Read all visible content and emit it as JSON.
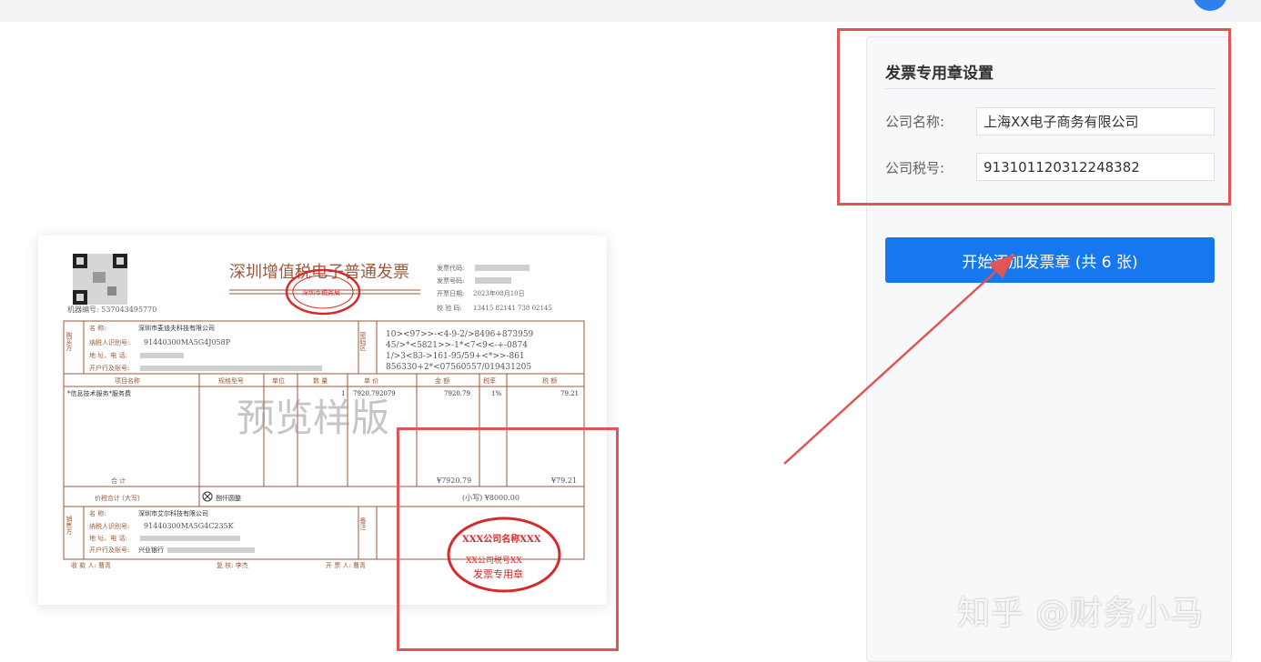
{
  "panel": {
    "title": "发票专用章设置",
    "company_name_label": "公司名称:",
    "company_name_value": "上海XX电子商务有限公司",
    "tax_id_label": "公司税号:",
    "tax_id_value": "913101120312248382",
    "start_button_label": "开始添加发票章 (共 6 张)"
  },
  "invoice": {
    "title": "深圳增值税电子普通发票",
    "machine_no": "机器编号: 537043495770",
    "code_label": "发票代码:",
    "number_label": "发票号码:",
    "date_label": "开票日期:",
    "date_value": "2023年08月10日",
    "check_label": "校 验 码:",
    "check_value": "13415 82141 738 02145",
    "buyer_side": "购买方",
    "buyer_name_label": "名    称:",
    "buyer_name": "深圳市麦迪夫科技有限公司",
    "buyer_tax_label": "纳税人识别号:",
    "buyer_tax": "91440300MA5G4J058P",
    "buyer_addr_label": "地 址、电 话:",
    "buyer_bank_label": "开户行及账号:",
    "password_side": "密码区",
    "cipher_lines": [
      "10><97>>-<4-9-2/>8496+873959",
      "45/>*<5821>>-1*<7<9<-+-0874",
      "1/>3<83->161-95/59+<*>>-861",
      "856330+2*<07560557/019431205"
    ],
    "col_item": "项目名称",
    "col_spec": "规格型号",
    "col_unit": "单位",
    "col_qty": "数 量",
    "col_price": "单 价",
    "col_amount": "金 额",
    "col_rate": "税率",
    "col_tax": "税 额",
    "item_name": "*信息技术服务*服务费",
    "item_qty": "1",
    "item_price": "7920.792079",
    "item_amount": "7920.79",
    "item_rate": "1%",
    "item_tax": "79.21",
    "total_label": "合    计",
    "total_amount": "¥7920.79",
    "total_tax": "¥79.21",
    "grand_label": "价税合计 (大写)",
    "grand_words": "捌仟圆整",
    "grand_small": "(小写) ¥8000.00",
    "seller_side": "销售方",
    "seller_name_label": "名    称:",
    "seller_name": "深圳市艾尔科技有限公司",
    "seller_tax_label": "纳税人识别号:",
    "seller_tax": "91440300MA5G4C235K",
    "seller_addr_label": "地 址、电 话:",
    "seller_bank_label": "开户行及账号:",
    "seller_bank": "兴业银行",
    "remark_side": "备注",
    "payee": "收 款 人: 曹青",
    "reviewer": "复 核: 李杰",
    "issuer": "开 票 人: 曹青",
    "preview_watermark": "预览样版",
    "stamp_top_text": "XXX公司名称XXX",
    "stamp_mid_text": "XX公司税号XX",
    "stamp_bottom_text": "发票专用章",
    "official_seal_text": "深圳市税务局"
  },
  "watermark": "知乎 @财务小马",
  "colors": {
    "accent": "#1677ee",
    "annotation": "#e05555",
    "invoice_brown": "#9b5a3c",
    "stamp_red": "#d42a2a"
  }
}
